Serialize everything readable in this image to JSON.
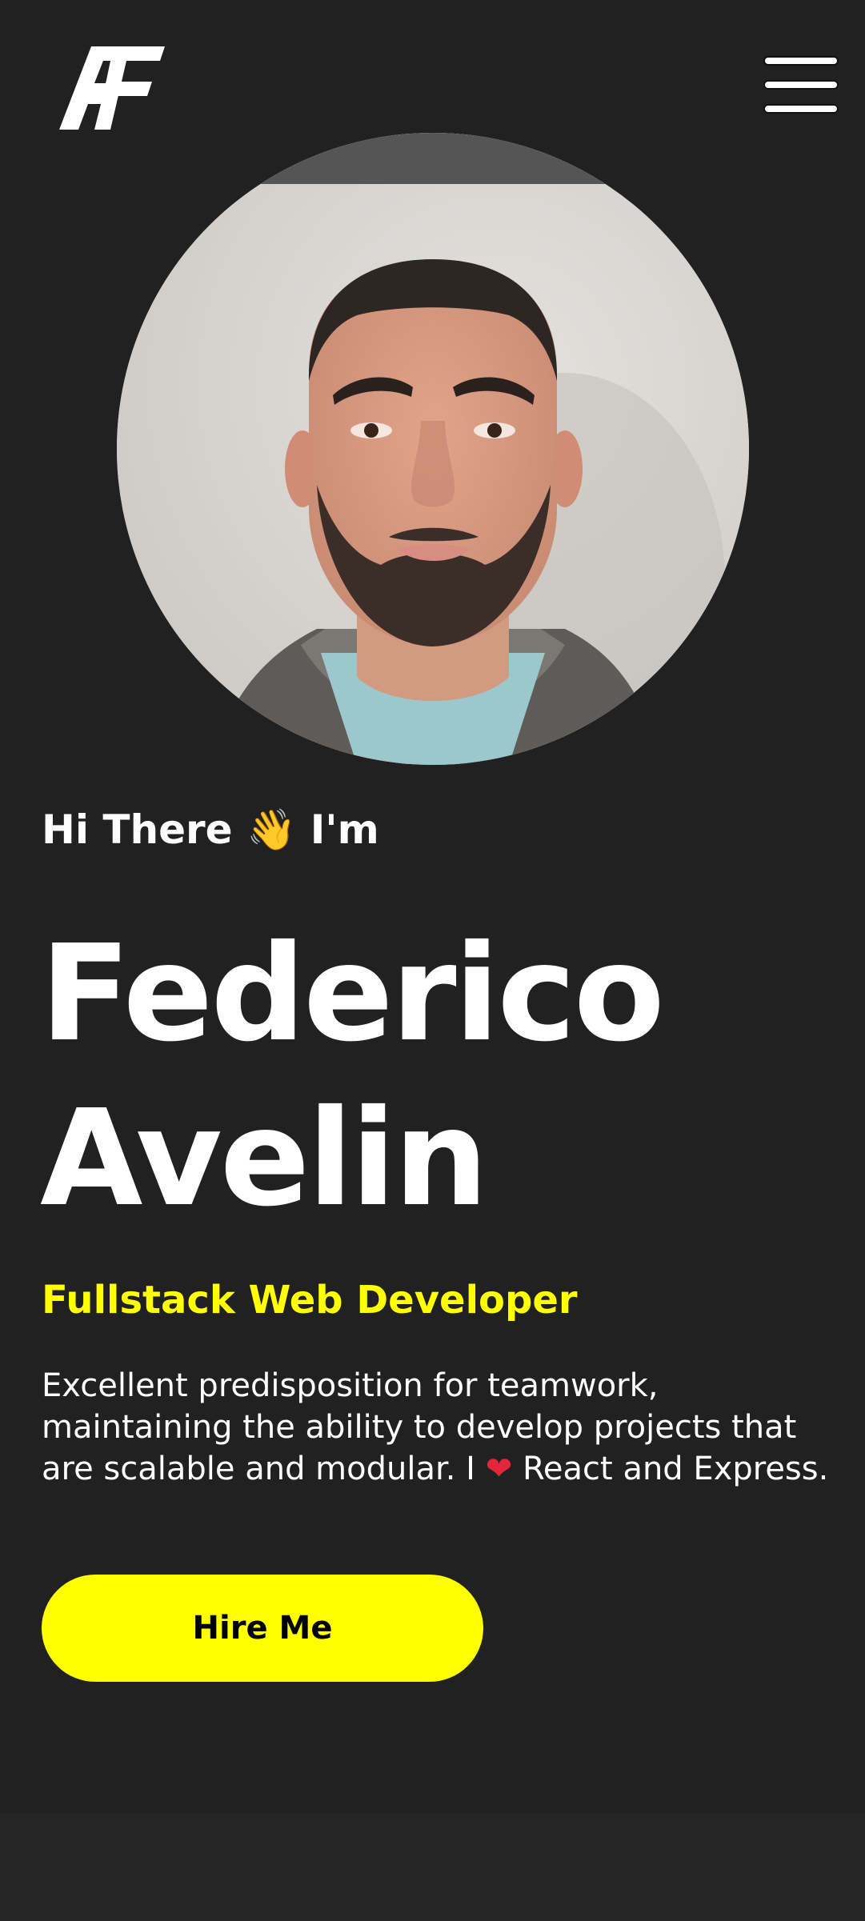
{
  "header": {
    "logo_text": "AF",
    "menu_icon": "hamburger-menu-icon"
  },
  "hero": {
    "greeting_prefix": "Hi There",
    "greeting_emoji": "👋",
    "greeting_suffix": "I'm",
    "name_first": "Federico",
    "name_last": "Avelin",
    "role": "Fullstack Web Developer",
    "bio_part1": "Excellent predisposition for teamwork, maintaining the ability to develop projects that are scalable and modular. I",
    "bio_heart": "❤",
    "bio_part2": "React and Express.",
    "hire_button_label": "Hire Me"
  },
  "colors": {
    "background": "#212121",
    "accent": "#ffff00",
    "text": "#ffffff",
    "heart": "#e3263b"
  }
}
